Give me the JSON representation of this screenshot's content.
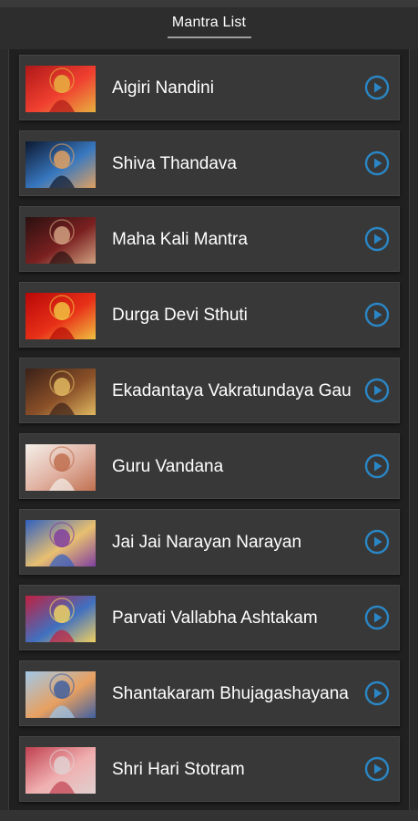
{
  "header": {
    "title": "Mantra List"
  },
  "accent_color": "#2a86c4",
  "items": [
    {
      "label": "Aigiri Nandini",
      "icon": "play-icon",
      "thumb_colors": [
        "#b01818",
        "#f04030",
        "#e8b040"
      ]
    },
    {
      "label": "Shiva Thandava",
      "icon": "play-icon",
      "thumb_colors": [
        "#0c1830",
        "#3878c0",
        "#e0a060"
      ]
    },
    {
      "label": "Maha Kali Mantra",
      "icon": "play-icon",
      "thumb_colors": [
        "#2a1010",
        "#7a2020",
        "#d0a080"
      ]
    },
    {
      "label": "Durga Devi Sthuti",
      "icon": "play-icon",
      "thumb_colors": [
        "#b80808",
        "#e83018",
        "#f0c040"
      ]
    },
    {
      "label": "Ekadantaya Vakratundaya Gau",
      "icon": "play-icon",
      "thumb_colors": [
        "#3a2018",
        "#8a5028",
        "#e0b860"
      ]
    },
    {
      "label": "Guru Vandana",
      "icon": "play-icon",
      "thumb_colors": [
        "#f4f0ea",
        "#e0b0a0",
        "#c07050"
      ]
    },
    {
      "label": "Jai Jai Narayan Narayan",
      "icon": "play-icon",
      "thumb_colors": [
        "#3060c0",
        "#e8c070",
        "#8040a0"
      ]
    },
    {
      "label": "Parvati Vallabha Ashtakam",
      "icon": "play-icon",
      "thumb_colors": [
        "#c02040",
        "#4070c0",
        "#f0d060"
      ]
    },
    {
      "label": "Shantakaram Bhujagashayana",
      "icon": "play-icon",
      "thumb_colors": [
        "#a0c8e8",
        "#e8a060",
        "#4060a0"
      ]
    },
    {
      "label": "Shri Hari Stotram",
      "icon": "play-icon",
      "thumb_colors": [
        "#c04050",
        "#f0b0b0",
        "#e0d0d0"
      ]
    }
  ]
}
